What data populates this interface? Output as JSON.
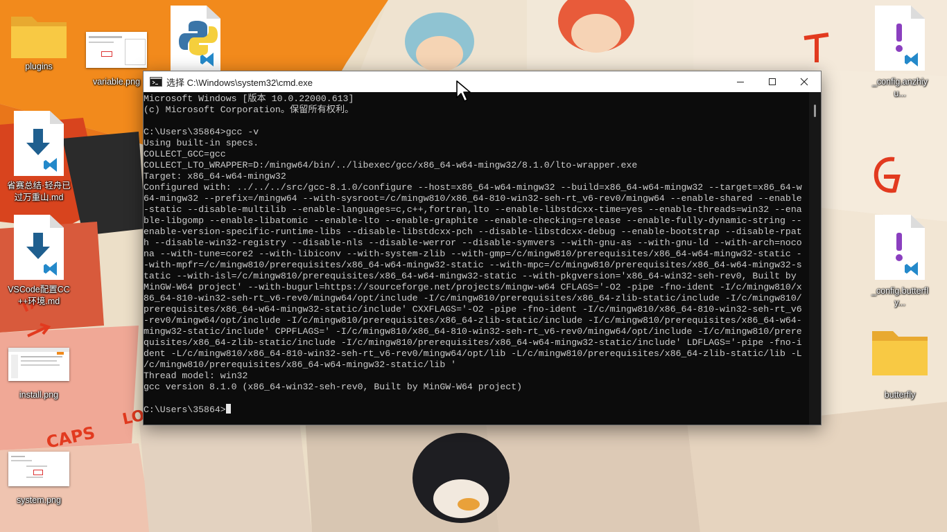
{
  "desktop": {
    "icons": [
      {
        "name": "plugins",
        "type": "folder"
      },
      {
        "name": "variable.png",
        "type": "image"
      },
      {
        "name": "",
        "type": "python-file"
      },
      {
        "name": "省赛总结·轻舟已过万重山.md",
        "type": "markdown"
      },
      {
        "name": "VSCode配置CC++环境.md",
        "type": "markdown"
      },
      {
        "name": "install.png",
        "type": "image"
      },
      {
        "name": "system.png",
        "type": "image"
      },
      {
        "name": "_config.anzhiyu...",
        "type": "yaml"
      },
      {
        "name": "_config.butterfly...",
        "type": "yaml"
      },
      {
        "name": "butterfly",
        "type": "folder"
      }
    ]
  },
  "window": {
    "title": "选择 C:\\Windows\\system32\\cmd.exe",
    "icon": "cmd-icon",
    "controls": {
      "minimize": "minimize-icon",
      "maximize": "maximize-icon",
      "close": "close-icon"
    }
  },
  "console": {
    "lines": [
      "Microsoft Windows [版本 10.0.22000.613]",
      "(c) Microsoft Corporation。保留所有权利。",
      "",
      "C:\\Users\\35864>gcc -v",
      "Using built-in specs.",
      "COLLECT_GCC=gcc",
      "COLLECT_LTO_WRAPPER=D:/mingw64/bin/../libexec/gcc/x86_64-w64-mingw32/8.1.0/lto-wrapper.exe",
      "Target: x86_64-w64-mingw32",
      "Configured with: ../../../src/gcc-8.1.0/configure --host=x86_64-w64-mingw32 --build=x86_64-w64-mingw32 --target=x86_64-w",
      "64-mingw32 --prefix=/mingw64 --with-sysroot=/c/mingw810/x86_64-810-win32-seh-rt_v6-rev0/mingw64 --enable-shared --enable",
      "-static --disable-multilib --enable-languages=c,c++,fortran,lto --enable-libstdcxx-time=yes --enable-threads=win32 --ena",
      "ble-libgomp --enable-libatomic --enable-lto --enable-graphite --enable-checking=release --enable-fully-dynamic-string --",
      "enable-version-specific-runtime-libs --disable-libstdcxx-pch --disable-libstdcxx-debug --enable-bootstrap --disable-rpat",
      "h --disable-win32-registry --disable-nls --disable-werror --disable-symvers --with-gnu-as --with-gnu-ld --with-arch=noco",
      "na --with-tune=core2 --with-libiconv --with-system-zlib --with-gmp=/c/mingw810/prerequisites/x86_64-w64-mingw32-static -",
      "-with-mpfr=/c/mingw810/prerequisites/x86_64-w64-mingw32-static --with-mpc=/c/mingw810/prerequisites/x86_64-w64-mingw32-s",
      "tatic --with-isl=/c/mingw810/prerequisites/x86_64-w64-mingw32-static --with-pkgversion='x86_64-win32-seh-rev0, Built by",
      "MinGW-W64 project' --with-bugurl=https://sourceforge.net/projects/mingw-w64 CFLAGS='-O2 -pipe -fno-ident -I/c/mingw810/x",
      "86_64-810-win32-seh-rt_v6-rev0/mingw64/opt/include -I/c/mingw810/prerequisites/x86_64-zlib-static/include -I/c/mingw810/",
      "prerequisites/x86_64-w64-mingw32-static/include' CXXFLAGS='-O2 -pipe -fno-ident -I/c/mingw810/x86_64-810-win32-seh-rt_v6",
      "-rev0/mingw64/opt/include -I/c/mingw810/prerequisites/x86_64-zlib-static/include -I/c/mingw810/prerequisites/x86_64-w64-",
      "mingw32-static/include' CPPFLAGS=' -I/c/mingw810/x86_64-810-win32-seh-rt_v6-rev0/mingw64/opt/include -I/c/mingw810/prere",
      "quisites/x86_64-zlib-static/include -I/c/mingw810/prerequisites/x86_64-w64-mingw32-static/include' LDFLAGS='-pipe -fno-i",
      "dent -L/c/mingw810/x86_64-810-win32-seh-rt_v6-rev0/mingw64/opt/lib -L/c/mingw810/prerequisites/x86_64-zlib-static/lib -L",
      "/c/mingw810/prerequisites/x86_64-w64-mingw32-static/lib '",
      "Thread model: win32",
      "gcc version 8.1.0 (x86_64-win32-seh-rev0, Built by MinGW-W64 project)",
      "",
      "C:\\Users\\35864>"
    ]
  },
  "colors": {
    "console_bg": "#0c0c0c",
    "console_fg": "#cccccc",
    "folder_yellow": "#f8c944",
    "vscode_blue": "#2489ca"
  }
}
